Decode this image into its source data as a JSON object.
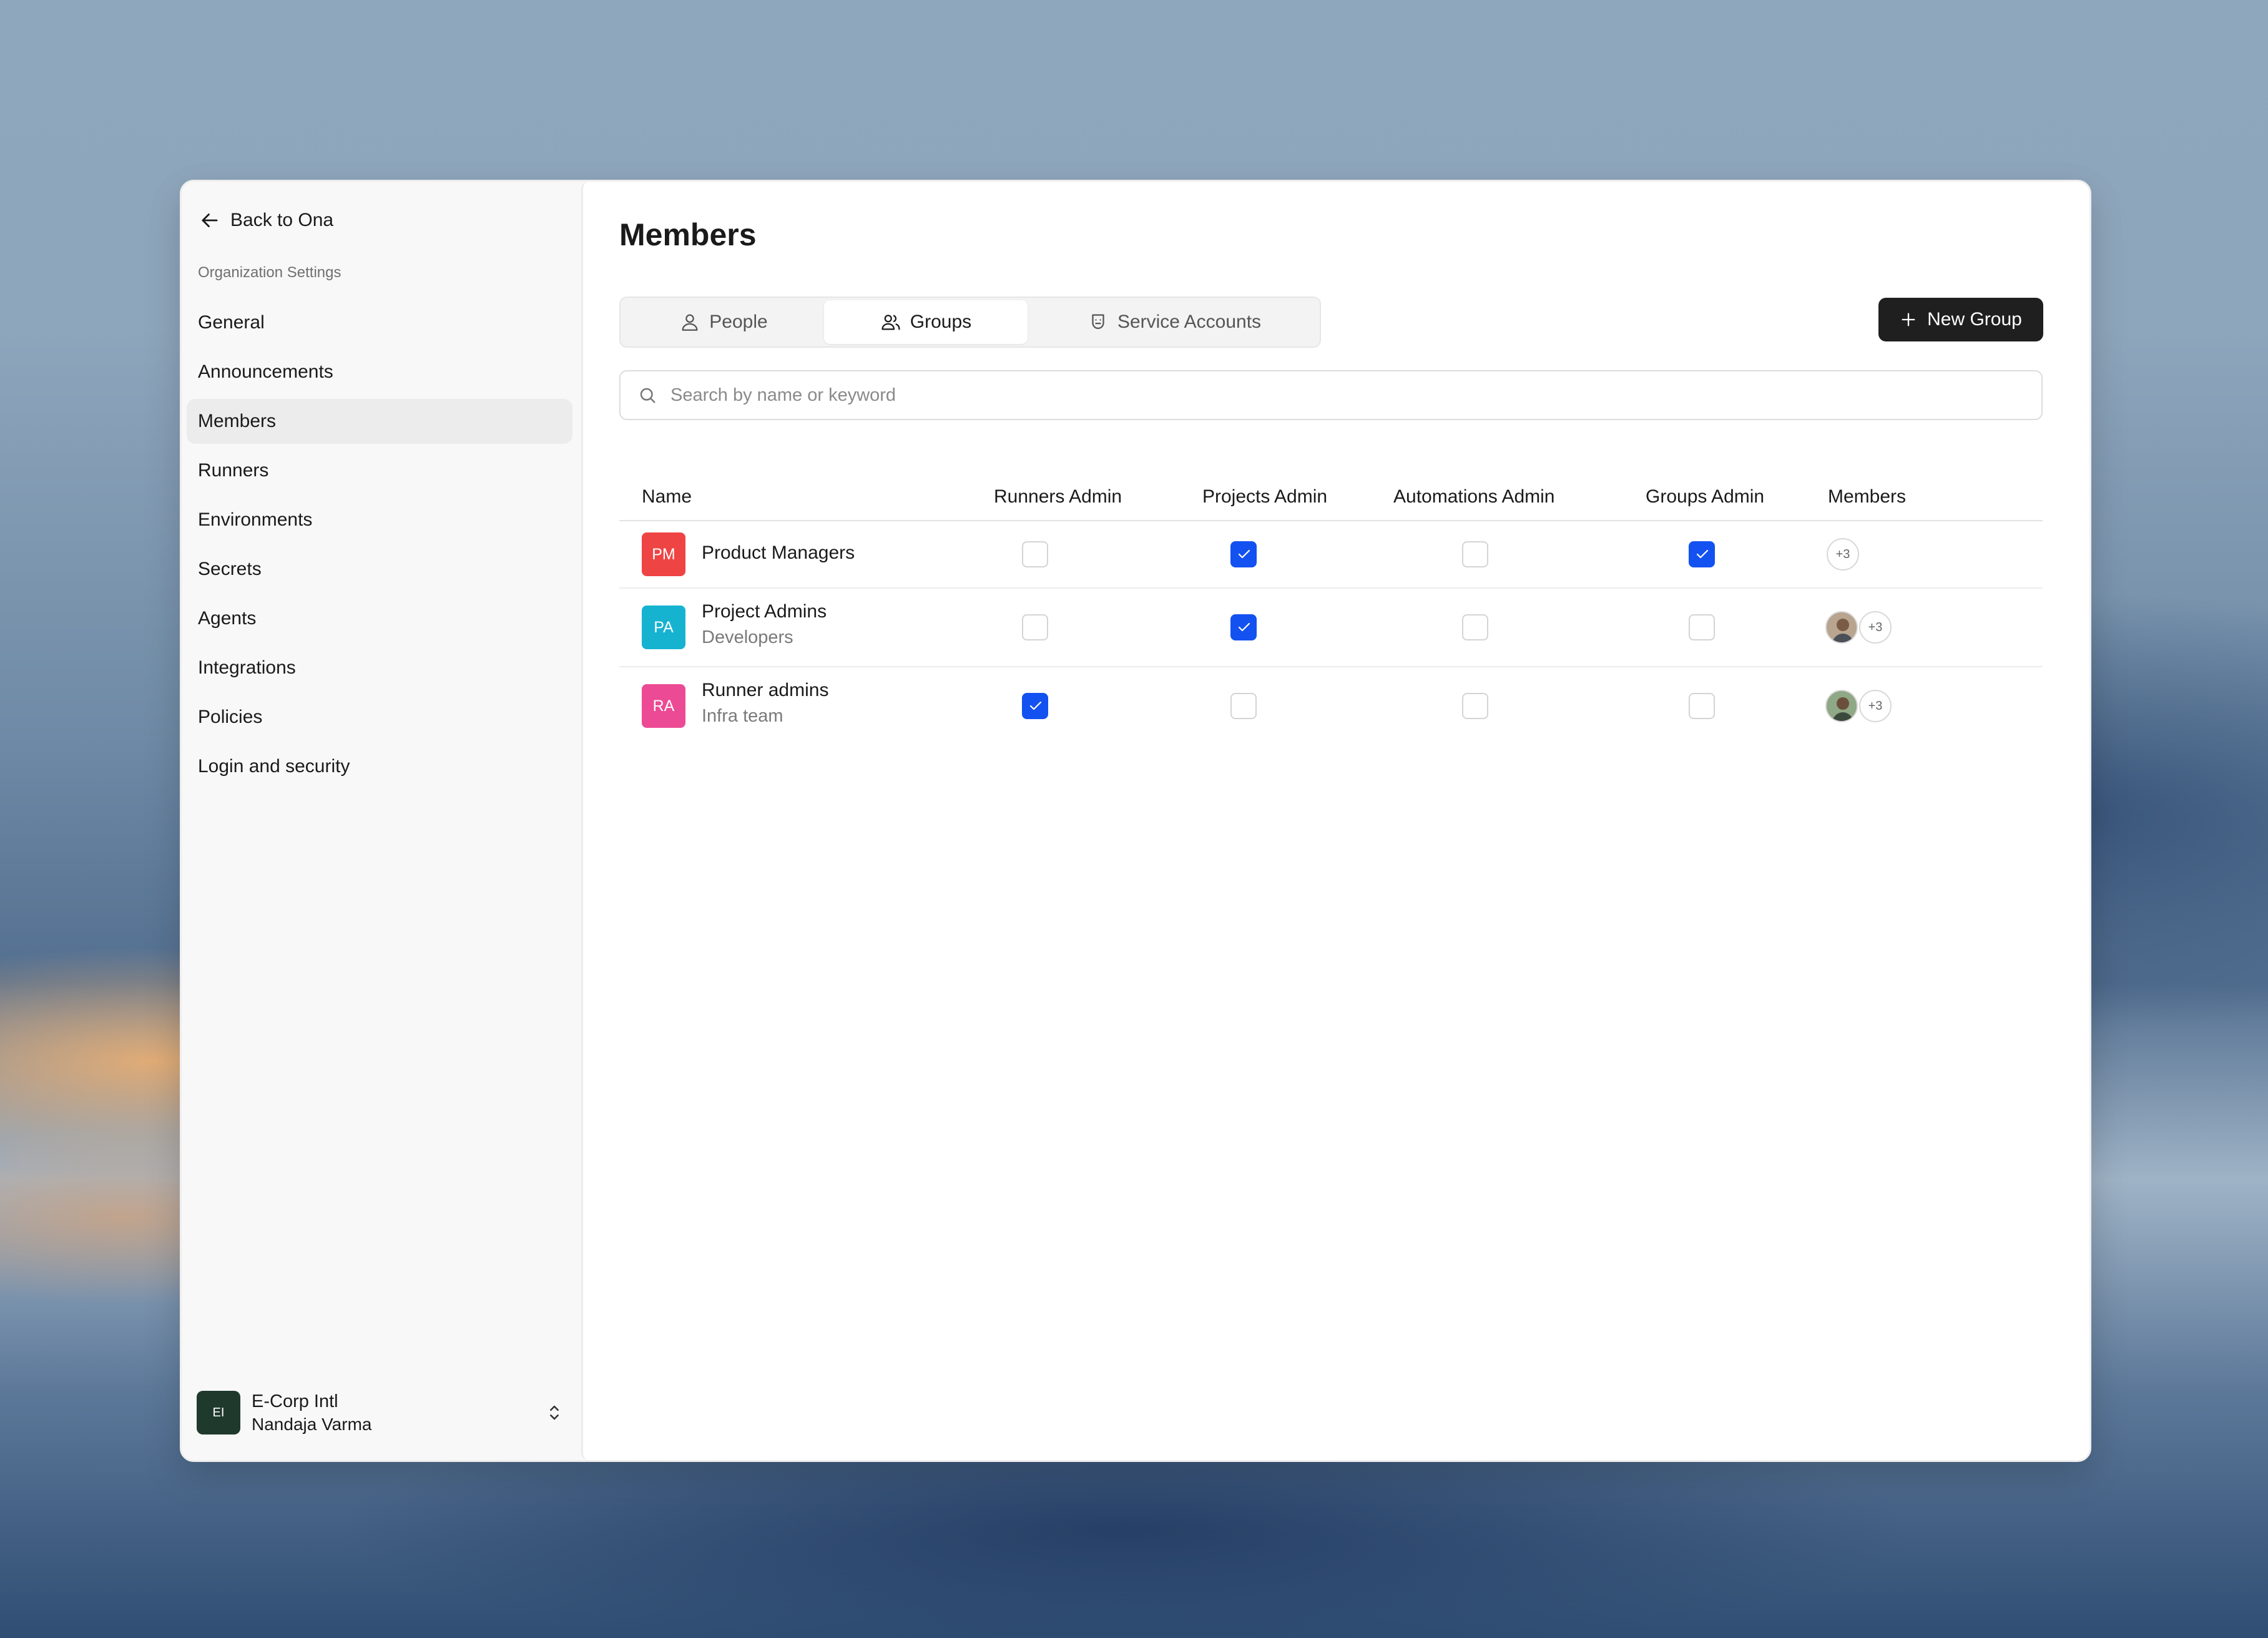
{
  "sidebar": {
    "back_label": "Back to Ona",
    "section_label": "Organization Settings",
    "items": [
      {
        "label": "General",
        "active": false
      },
      {
        "label": "Announcements",
        "active": false
      },
      {
        "label": "Members",
        "active": true
      },
      {
        "label": "Runners",
        "active": false
      },
      {
        "label": "Environments",
        "active": false
      },
      {
        "label": "Secrets",
        "active": false
      },
      {
        "label": "Agents",
        "active": false
      },
      {
        "label": "Integrations",
        "active": false
      },
      {
        "label": "Policies",
        "active": false
      },
      {
        "label": "Login and security",
        "active": false
      }
    ],
    "org": {
      "initials": "EI",
      "name": "E-Corp Intl",
      "user": "Nandaja Varma",
      "avatar_color": "#1f3a2c"
    }
  },
  "main": {
    "title": "Members",
    "tabs": [
      {
        "label": "People",
        "icon": "user-icon",
        "selected": false
      },
      {
        "label": "Groups",
        "icon": "users-icon",
        "selected": true
      },
      {
        "label": "Service Accounts",
        "icon": "shield-bot-icon",
        "selected": false
      }
    ],
    "new_group_label": "New Group",
    "search": {
      "placeholder": "Search by name or keyword",
      "value": ""
    },
    "table": {
      "columns": [
        "Name",
        "Runners Admin",
        "Projects Admin",
        "Automations Admin",
        "Groups Admin",
        "Members"
      ],
      "rows": [
        {
          "initials": "PM",
          "color": "#ef4444",
          "name": "Product Managers",
          "subtitle": "",
          "runners_admin": false,
          "projects_admin": true,
          "automations_admin": false,
          "groups_admin": true,
          "members_more": "+3",
          "has_avatar": false
        },
        {
          "initials": "PA",
          "color": "#16b3d1",
          "name": "Project Admins",
          "subtitle": "Developers",
          "runners_admin": false,
          "projects_admin": true,
          "automations_admin": false,
          "groups_admin": false,
          "members_more": "+3",
          "has_avatar": true
        },
        {
          "initials": "RA",
          "color": "#ec4a94",
          "name": "Runner admins",
          "subtitle": "Infra team",
          "runners_admin": true,
          "projects_admin": false,
          "automations_admin": false,
          "groups_admin": false,
          "members_more": "+3",
          "has_avatar": true
        }
      ]
    }
  },
  "colors": {
    "accent": "#1352f1",
    "button_dark": "#1f1f1f"
  }
}
